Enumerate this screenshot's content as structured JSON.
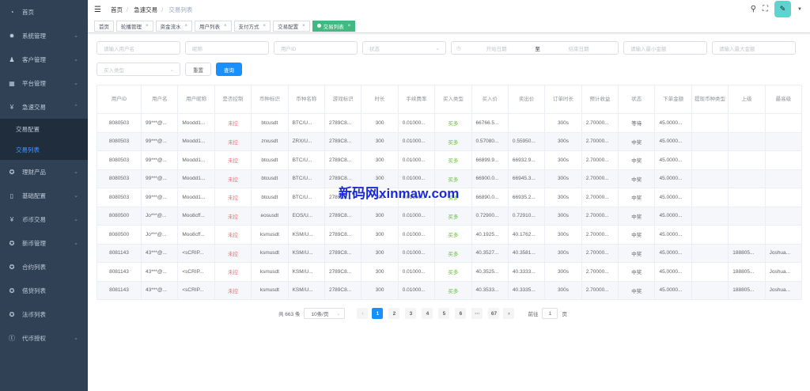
{
  "sidebar": {
    "items": [
      {
        "label": "首页",
        "icon": "dashboard-icon",
        "chev": false
      },
      {
        "label": "系统管理",
        "icon": "gear-icon",
        "chev": true
      },
      {
        "label": "客户管理",
        "icon": "user-icon",
        "chev": true
      },
      {
        "label": "平台管理",
        "icon": "grid-icon",
        "chev": true
      },
      {
        "label": "急速交易",
        "icon": "yen-icon",
        "chev": true,
        "open": true,
        "children": [
          {
            "label": "交易配置"
          },
          {
            "label": "交易列表",
            "active": true
          }
        ]
      },
      {
        "label": "理财产品",
        "icon": "circle-icon",
        "chev": true
      },
      {
        "label": "基础配置",
        "icon": "book-icon",
        "chev": true
      },
      {
        "label": "币币交易",
        "icon": "yen-icon",
        "chev": true
      },
      {
        "label": "新币管理",
        "icon": "circle-icon",
        "chev": true
      },
      {
        "label": "合约列表",
        "icon": "circle-icon",
        "chev": false
      },
      {
        "label": "借贷列表",
        "icon": "circle-icon",
        "chev": false
      },
      {
        "label": "法币列表",
        "icon": "circle-icon",
        "chev": false
      },
      {
        "label": "代币授权",
        "icon": "token-icon",
        "chev": true
      }
    ]
  },
  "breadcrumb": [
    "首页",
    "急速交易",
    "交易列表"
  ],
  "tags": [
    {
      "label": "首页",
      "closable": false
    },
    {
      "label": "轮播管理",
      "closable": true
    },
    {
      "label": "资金流水",
      "closable": true
    },
    {
      "label": "用户列表",
      "closable": true
    },
    {
      "label": "支付方式",
      "closable": true
    },
    {
      "label": "交易配置",
      "closable": true
    },
    {
      "label": "交易列表",
      "closable": true,
      "active": true
    }
  ],
  "filters": {
    "username": "请输入用户名",
    "nickname": "昵称",
    "userid": "用户ID",
    "status": "状态",
    "start_date": "开始日期",
    "to": "至",
    "end_date": "结束日期",
    "min_amount": "请输入最小金额",
    "max_amount": "请输入最大金额",
    "buy_type": "买入类型",
    "reset": "重置",
    "search": "查询"
  },
  "table": {
    "headers": [
      "用户ID",
      "用户名",
      "用户昵称",
      "是否控制",
      "币种标识",
      "币种名称",
      "游戏标识",
      "时长",
      "手续费率",
      "买入类型",
      "买入价",
      "卖出价",
      "订单时长",
      "预计收益",
      "状态",
      "下单金额",
      "提现币种类型",
      "上级",
      "最高级"
    ],
    "rows": [
      [
        "8080503",
        "99***@...",
        "Moodd1...",
        "未控",
        "btcusdt",
        "BTC/U...",
        "2789C8...",
        "300",
        "0.01000...",
        "买多",
        "66766.5...",
        "",
        "300s",
        "2.70000...",
        "等待",
        "45.0000...",
        "",
        "",
        ""
      ],
      [
        "8080503",
        "99***@...",
        "Moodd1...",
        "未控",
        "zrxusdt",
        "ZRX/U...",
        "2789C8...",
        "300",
        "0.01000...",
        "买多",
        "0.57080...",
        "0.55950...",
        "300s",
        "2.70000...",
        "中奖",
        "45.0000...",
        "",
        "",
        ""
      ],
      [
        "8080503",
        "99***@...",
        "Moodd1...",
        "未控",
        "btcusdt",
        "BTC/U...",
        "2789C8...",
        "300",
        "0.01000...",
        "买多",
        "66899.9...",
        "66932.9...",
        "300s",
        "2.70000...",
        "中奖",
        "45.0000...",
        "",
        "",
        ""
      ],
      [
        "8080503",
        "99***@...",
        "Moodd1...",
        "未控",
        "btcusdt",
        "BTC/U...",
        "2789C8...",
        "300",
        "0.01000...",
        "买多",
        "66900.0...",
        "66945.3...",
        "300s",
        "2.70000...",
        "中奖",
        "45.0000...",
        "",
        "",
        ""
      ],
      [
        "8080503",
        "99***@...",
        "Moodd1...",
        "未控",
        "btcusdt",
        "BTC/U...",
        "2789C8...",
        "300",
        "0.01000...",
        "买多",
        "66890.0...",
        "66935.2...",
        "300s",
        "2.70000...",
        "中奖",
        "45.0000...",
        "",
        "",
        ""
      ],
      [
        "8080500",
        "Jo***@...",
        "Moo8cff...",
        "未控",
        "eosusdt",
        "EOS/U...",
        "2789C8...",
        "300",
        "0.01000...",
        "买多",
        "0.72900...",
        "0.72910...",
        "300s",
        "2.70000...",
        "中奖",
        "45.0000...",
        "",
        "",
        ""
      ],
      [
        "8080500",
        "Jo***@...",
        "Moo8cff...",
        "未控",
        "ksmusdt",
        "KSM/U...",
        "2789C8...",
        "300",
        "0.01000...",
        "买多",
        "40.1925...",
        "40.1762...",
        "300s",
        "2.70000...",
        "中奖",
        "45.0000...",
        "",
        "",
        ""
      ],
      [
        "8081143",
        "43***@...",
        "<sCRIP...",
        "未控",
        "ksmusdt",
        "KSM/U...",
        "2789C8...",
        "300",
        "0.01000...",
        "买多",
        "40.3527...",
        "40.3581...",
        "300s",
        "2.70000...",
        "中奖",
        "45.0000...",
        "",
        "188805...",
        "Joshua..."
      ],
      [
        "8081143",
        "43***@...",
        "<sCRIP...",
        "未控",
        "ksmusdt",
        "KSM/U...",
        "2789C8...",
        "300",
        "0.01000...",
        "买多",
        "40.3525...",
        "40.3333...",
        "300s",
        "2.70000...",
        "中奖",
        "45.0000...",
        "",
        "188805...",
        "Joshua..."
      ],
      [
        "8081143",
        "43***@...",
        "<sCRIP...",
        "未控",
        "ksmusdt",
        "KSM/U...",
        "2789C8...",
        "300",
        "0.01000...",
        "买多",
        "40.3533...",
        "40.3335...",
        "300s",
        "2.70000...",
        "中奖",
        "45.0000...",
        "",
        "188805...",
        "Joshua..."
      ]
    ]
  },
  "pagination": {
    "total": "共 663 条",
    "page_size": "10条/页",
    "pages": [
      "1",
      "2",
      "3",
      "4",
      "5",
      "6",
      "···",
      "67"
    ],
    "current": "1",
    "goto_label": "前往",
    "goto_value": "1",
    "page_suffix": "页"
  },
  "watermark": "新码网xinmaw.com",
  "colors": {
    "sidebar": "#304156",
    "primary": "#1890ff",
    "tag_active": "#42b983",
    "red": "#f56c6c",
    "green": "#67c23a"
  }
}
